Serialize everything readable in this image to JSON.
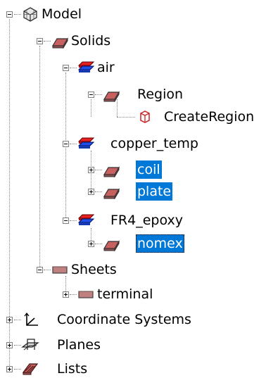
{
  "nodes": {
    "model": "Model",
    "solids": "Solids",
    "air": "air",
    "region": "Region",
    "create_region": "CreateRegion",
    "copper_temp": "copper_temp",
    "coil": "coil",
    "plate": "plate",
    "fr4_epoxy": "FR4_epoxy",
    "nomex": "nomex",
    "sheets": "Sheets",
    "terminal": "terminal",
    "coordinate_systems": "Coordinate Systems",
    "planes": "Planes",
    "lists": "Lists"
  },
  "colors": {
    "selection": "#0078d7",
    "solid_icon_fill": "#c86060",
    "material_red": "#e82020",
    "material_blue": "#2050e8",
    "sheet_icon_fill": "#c08080",
    "create_region_icon": "#d02020"
  },
  "icons": {
    "model": "model-icon",
    "solid_folder": "solid-box-icon",
    "material": "material-group-icon",
    "create_region": "create-region-icon",
    "sheet": "sheet-icon",
    "coordinate_systems": "coordinate-axes-icon",
    "planes": "planes-icon",
    "lists": "lists-icon"
  }
}
